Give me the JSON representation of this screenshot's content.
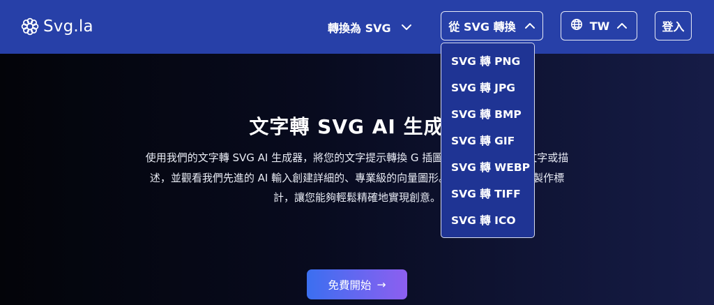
{
  "header": {
    "brand": "Svg.la",
    "nav_convert_to": "轉換為 SVG",
    "nav_convert_from": "從 SVG 轉換",
    "language": "TW",
    "login": "登入"
  },
  "dropdown": {
    "items": [
      "SVG 轉 PNG",
      "SVG 轉 JPG",
      "SVG 轉 BMP",
      "SVG 轉 GIF",
      "SVG 轉 WEBP",
      "SVG 轉 TIFF",
      "SVG 轉 ICO"
    ]
  },
  "hero": {
    "title": "文字轉 SVG AI 生成",
    "description": "使用我們的文字轉 SVG AI 生成器，將您的文字提示轉換 G 插圖。只需輸入所需的文字或描述，並觀看我們先進的 AI 輸入創建詳細的、專業級的向量圖形。這款工具非常適合製作標 計，讓您能夠輕鬆精確地實現創意。",
    "cta_label": "免費開始",
    "cta_arrow": "→"
  },
  "icons": {
    "logo": "flower-logo-icon",
    "globe": "globe-icon",
    "chevron_down": "chevron-down-icon",
    "chevron_up": "chevron-up-icon",
    "arrow_right": "arrow-right-icon"
  },
  "colors": {
    "header_bg": "#2740a8",
    "dropdown_bg": "#1f3494",
    "cta_gradient_start": "#3b6ff0",
    "cta_gradient_end": "#8d5ff0"
  }
}
